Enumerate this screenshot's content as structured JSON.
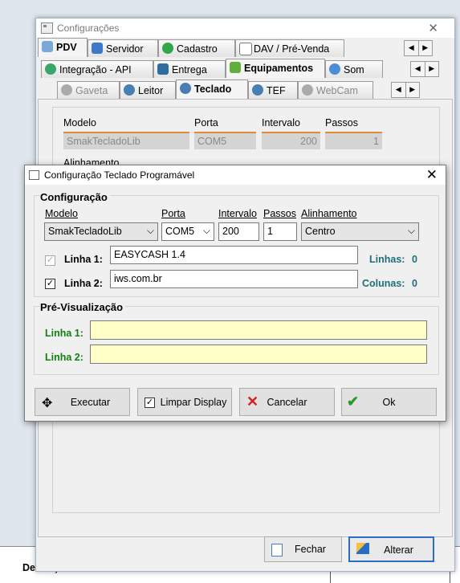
{
  "background": {
    "description_header": "Descrição"
  },
  "main_window": {
    "title": "Configurações",
    "close_glyph": "✕",
    "tabs_row1": [
      {
        "label": "PDV",
        "icon": "pdv-icon"
      },
      {
        "label": "Servidor",
        "icon": "server-icon"
      },
      {
        "label": "Cadastro",
        "icon": "add-icon"
      },
      {
        "label": "DAV / Pré-Venda",
        "icon": "document-icon"
      }
    ],
    "tabs_row2": [
      {
        "label": "Integração - API",
        "icon": "refresh-icon"
      },
      {
        "label": "Entrega",
        "icon": "printer-icon"
      },
      {
        "label": "Equipamentos",
        "icon": "puzzle-icon"
      },
      {
        "label": "Som",
        "icon": "speaker-icon"
      }
    ],
    "tabs_row3": [
      {
        "label": "Gaveta",
        "icon": "gear-icon"
      },
      {
        "label": "Leitor",
        "icon": "gear-icon"
      },
      {
        "label": "Teclado",
        "icon": "gear-icon"
      },
      {
        "label": "TEF",
        "icon": "gear-icon"
      },
      {
        "label": "WebCam",
        "icon": "gear-icon"
      }
    ],
    "fields": {
      "modelo_label": "Modelo",
      "modelo_value": "SmakTecladoLib",
      "porta_label": "Porta",
      "porta_value": "COM5",
      "intervalo_label": "Intervalo",
      "intervalo_value": "200",
      "passos_label": "Passos",
      "passos_value": "1",
      "alinhamento_label": "Alinhamento"
    },
    "buttons": {
      "fechar": "Fechar",
      "alterar": "Alterar"
    }
  },
  "dialog": {
    "title": "Configuração Teclado Programável",
    "close_glyph": "✕",
    "config_group": "Configuração",
    "labels": {
      "modelo": "Modelo",
      "porta": "Porta",
      "intervalo": "Intervalo",
      "passos": "Passos",
      "alinhamento": "Alinhamento"
    },
    "values": {
      "modelo": "SmakTecladoLib",
      "porta": "COM5",
      "intervalo": "200",
      "passos": "1",
      "alinhamento": "Centro"
    },
    "linha1_label": "Linha 1:",
    "linha1_value": "EASYCASH 1.4",
    "linha1_checked": true,
    "linha2_label": "Linha 2:",
    "linha2_value": "iws.com.br",
    "linha2_checked": true,
    "linhas_label": "Linhas:",
    "linhas_value": "0",
    "colunas_label": "Colunas:",
    "colunas_value": "0",
    "preview_group": "Pré-Visualização",
    "preview_linha1_label": "Linha 1:",
    "preview_linha1_value": "",
    "preview_linha2_label": "Linha 2:",
    "preview_linha2_value": "",
    "buttons": {
      "executar": "Executar",
      "limpar_display": "Limpar Display",
      "limpar_checked": true,
      "cancelar": "Cancelar",
      "ok": "Ok"
    }
  },
  "colors": {
    "accent_orange": "#e08a3c",
    "green_label": "#108010",
    "teal_label": "#1f6f7a",
    "preview_bg": "#ffffc8",
    "focus_blue": "#2b6cc4"
  }
}
